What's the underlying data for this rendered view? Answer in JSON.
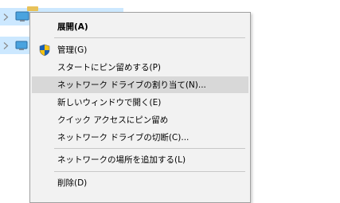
{
  "tree": {
    "rows": [
      {
        "name": "tree-row-1"
      },
      {
        "name": "tree-row-2"
      }
    ]
  },
  "context_menu": {
    "items": [
      {
        "label": "展開(A)",
        "bold": true
      },
      {
        "label": "管理(G)",
        "icon": "shield-icon"
      },
      {
        "label": "スタートにピン留めする(P)"
      },
      {
        "label": "ネットワーク ドライブの割り当て(N)...",
        "hovered": true
      },
      {
        "label": "新しいウィンドウで開く(E)"
      },
      {
        "label": "クイック アクセスにピン留め"
      },
      {
        "label": "ネットワーク ドライブの切断(C)..."
      },
      {
        "label": "ネットワークの場所を追加する(L)"
      },
      {
        "label": "削除(D)"
      }
    ]
  },
  "colors": {
    "menu_bg": "#f2f2f2",
    "hover_bg": "#d8d8d8",
    "tree_selection": "#cce8ff",
    "shield_blue": "#1a5fb4",
    "shield_yellow": "#f5c211"
  }
}
